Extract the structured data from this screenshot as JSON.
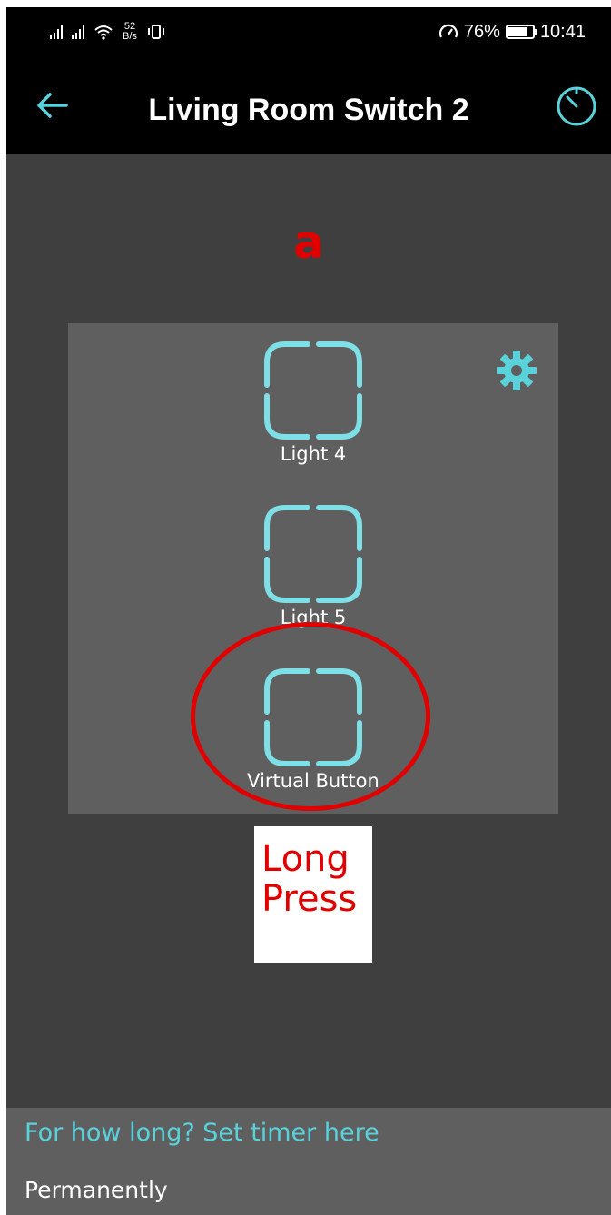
{
  "status_bar": {
    "network_speed_value": "52",
    "network_speed_unit": "B/s",
    "battery_percent": "76%",
    "battery_level": 0.76,
    "time": "10:41"
  },
  "app_bar": {
    "title": "Living Room Switch 2",
    "back_icon": "arrow-left-icon",
    "timer_icon": "timer-icon"
  },
  "annotation": {
    "label": "a",
    "note_line1": "Long",
    "note_line2": "Press"
  },
  "panel": {
    "settings_icon": "gear-icon",
    "switches": [
      {
        "label": "Light 4"
      },
      {
        "label": "Light 5"
      },
      {
        "label": "Virtual Button"
      }
    ]
  },
  "timer_sheet": {
    "title": "For how long? Set timer here",
    "option": "Permanently"
  },
  "colors": {
    "accent": "#5ad2dc",
    "annotation": "#e00000",
    "background": "#3f3f3f",
    "panel": "#5f5f5f",
    "bar": "#000000"
  }
}
